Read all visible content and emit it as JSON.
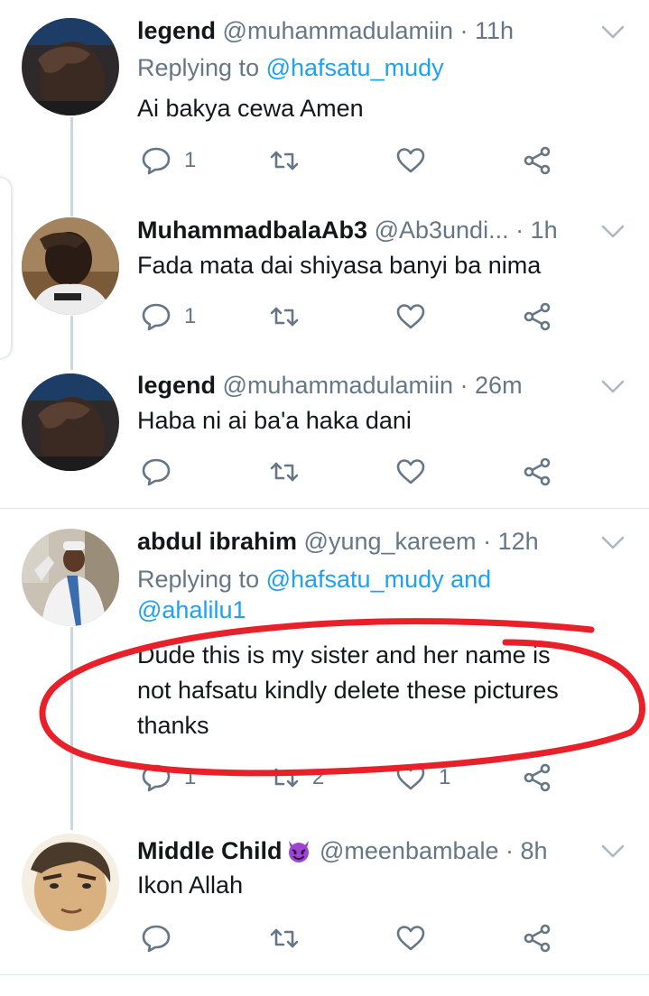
{
  "tweets": [
    {
      "name": "legend",
      "handle": "@muhammadulamiin",
      "sep": " · ",
      "time": "11h",
      "reply_prefix": "Replying to ",
      "reply_to": "@hafsatu_mudy",
      "text": "Ai bakya cewa Amen",
      "replies": "1",
      "retweets": "",
      "likes": ""
    },
    {
      "name": "MuhammadbalaAb3",
      "handle": "@Ab3undi...",
      "sep": " · ",
      "time": "1h",
      "text": "Fada mata dai shiyasa banyi ba nima",
      "replies": "1",
      "retweets": "",
      "likes": ""
    },
    {
      "name": "legend",
      "handle": "@muhammadulamiin",
      "sep": " · ",
      "time": "26m",
      "text": "Haba ni ai ba'a haka dani",
      "replies": "",
      "retweets": "",
      "likes": ""
    },
    {
      "name": "abdul ibrahim",
      "handle": "@yung_kareem",
      "sep": " · ",
      "time": "12h",
      "reply_prefix": "Replying to ",
      "reply_to": "@hafsatu_mudy and",
      "reply_to_2": "@ahalilu1",
      "text_line1": "Dude this is my sister and her name is",
      "text_line2": "not hafsatu kindly delete these pictures",
      "text_line3": "thanks",
      "replies": "1",
      "retweets": "2",
      "likes": "1"
    },
    {
      "name": "Middle Child",
      "handle": "@meenbambale",
      "sep": " · ",
      "time": "8h",
      "text": "Ikon Allah",
      "replies": "",
      "retweets": "",
      "likes": ""
    }
  ],
  "icons": [
    "reply-icon",
    "retweet-icon",
    "like-icon",
    "share-icon",
    "chevron-down-icon",
    "devil-emoji-icon"
  ],
  "colors": {
    "link": "#1da1f2",
    "muted": "#657786",
    "text": "#14171a",
    "annotation": "#e8202a",
    "thread_line": "#ccd6dd"
  }
}
